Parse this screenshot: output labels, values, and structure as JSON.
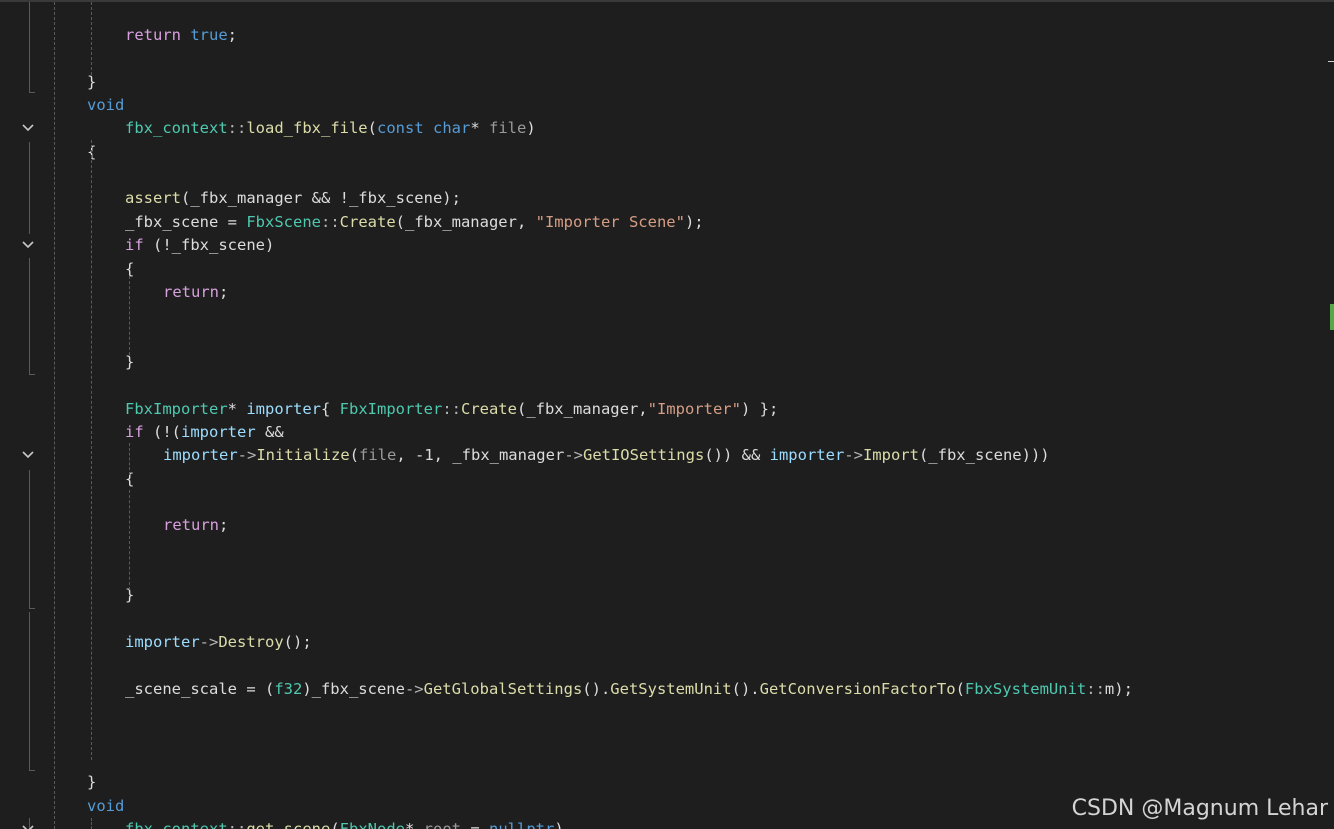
{
  "editor": {
    "lines": [
      {
        "indent": 2,
        "fold": false,
        "tokens": [
          {
            "t": "return",
            "c": "ctl"
          },
          {
            "t": " ",
            "c": "pl"
          },
          {
            "t": "true",
            "c": "kw"
          },
          {
            "t": ";",
            "c": "pl"
          }
        ]
      },
      {
        "indent": 1,
        "fold": false,
        "tokens": []
      },
      {
        "indent": 1,
        "fold": false,
        "tokens": [
          {
            "t": "}",
            "c": "pl"
          }
        ]
      },
      {
        "indent": 1,
        "fold": false,
        "tokens": [
          {
            "t": "void",
            "c": "kw"
          }
        ]
      },
      {
        "indent": 2,
        "fold": true,
        "tokens": [
          {
            "t": "fbx_context",
            "c": "typ"
          },
          {
            "t": "::",
            "c": "op"
          },
          {
            "t": "load_fbx_file",
            "c": "fn"
          },
          {
            "t": "(",
            "c": "pl"
          },
          {
            "t": "const",
            "c": "kw"
          },
          {
            "t": " ",
            "c": "pl"
          },
          {
            "t": "char",
            "c": "kw"
          },
          {
            "t": "* ",
            "c": "pl"
          },
          {
            "t": "file",
            "c": "param"
          },
          {
            "t": ")",
            "c": "pl"
          }
        ]
      },
      {
        "indent": 1,
        "fold": false,
        "tokens": [
          {
            "t": "{",
            "c": "pl"
          }
        ]
      },
      {
        "indent": 2,
        "fold": false,
        "tokens": []
      },
      {
        "indent": 2,
        "fold": false,
        "tokens": [
          {
            "t": "assert",
            "c": "fn"
          },
          {
            "t": "(_fbx_manager && !_fbx_scene);",
            "c": "pl"
          }
        ]
      },
      {
        "indent": 2,
        "fold": false,
        "tokens": [
          {
            "t": "_fbx_scene = ",
            "c": "pl"
          },
          {
            "t": "FbxScene",
            "c": "typ"
          },
          {
            "t": "::",
            "c": "op"
          },
          {
            "t": "Create",
            "c": "fn"
          },
          {
            "t": "(_fbx_manager, ",
            "c": "pl"
          },
          {
            "t": "\"Importer Scene\"",
            "c": "str"
          },
          {
            "t": ");",
            "c": "pl"
          }
        ]
      },
      {
        "indent": 2,
        "fold": true,
        "tokens": [
          {
            "t": "if",
            "c": "ctl"
          },
          {
            "t": " (!_fbx_scene)",
            "c": "pl"
          }
        ]
      },
      {
        "indent": 2,
        "fold": false,
        "tokens": [
          {
            "t": "{",
            "c": "pl"
          }
        ]
      },
      {
        "indent": 3,
        "fold": false,
        "tokens": [
          {
            "t": "return",
            "c": "ctl"
          },
          {
            "t": ";",
            "c": "pl"
          }
        ]
      },
      {
        "indent": 3,
        "fold": false,
        "tokens": []
      },
      {
        "indent": 3,
        "fold": false,
        "tokens": []
      },
      {
        "indent": 2,
        "fold": false,
        "tokens": [
          {
            "t": "}",
            "c": "pl"
          }
        ]
      },
      {
        "indent": 2,
        "fold": false,
        "tokens": []
      },
      {
        "indent": 2,
        "fold": false,
        "tokens": [
          {
            "t": "FbxImporter",
            "c": "typ"
          },
          {
            "t": "* ",
            "c": "pl"
          },
          {
            "t": "importer",
            "c": "var"
          },
          {
            "t": "{ ",
            "c": "pl"
          },
          {
            "t": "FbxImporter",
            "c": "typ"
          },
          {
            "t": "::",
            "c": "op"
          },
          {
            "t": "Create",
            "c": "fn"
          },
          {
            "t": "(_fbx_manager,",
            "c": "pl"
          },
          {
            "t": "\"Importer\"",
            "c": "str"
          },
          {
            "t": ") };",
            "c": "pl"
          }
        ]
      },
      {
        "indent": 2,
        "fold": false,
        "tokens": [
          {
            "t": "if",
            "c": "ctl"
          },
          {
            "t": " (!(",
            "c": "pl"
          },
          {
            "t": "importer",
            "c": "var"
          },
          {
            "t": " &&",
            "c": "pl"
          }
        ]
      },
      {
        "indent": 3,
        "fold": true,
        "tokens": [
          {
            "t": "importer",
            "c": "var"
          },
          {
            "t": "->",
            "c": "op"
          },
          {
            "t": "Initialize",
            "c": "fn"
          },
          {
            "t": "(",
            "c": "pl"
          },
          {
            "t": "file",
            "c": "param"
          },
          {
            "t": ", -1, _fbx_manager",
            "c": "pl"
          },
          {
            "t": "->",
            "c": "op"
          },
          {
            "t": "GetIOSettings",
            "c": "fn"
          },
          {
            "t": "()) && ",
            "c": "pl"
          },
          {
            "t": "importer",
            "c": "var"
          },
          {
            "t": "->",
            "c": "op"
          },
          {
            "t": "Import",
            "c": "fn"
          },
          {
            "t": "(_fbx_scene)))",
            "c": "pl"
          }
        ]
      },
      {
        "indent": 2,
        "fold": false,
        "tokens": [
          {
            "t": "{",
            "c": "pl"
          }
        ]
      },
      {
        "indent": 3,
        "fold": false,
        "tokens": []
      },
      {
        "indent": 3,
        "fold": false,
        "tokens": [
          {
            "t": "return",
            "c": "ctl"
          },
          {
            "t": ";",
            "c": "pl"
          }
        ]
      },
      {
        "indent": 3,
        "fold": false,
        "tokens": []
      },
      {
        "indent": 3,
        "fold": false,
        "tokens": []
      },
      {
        "indent": 2,
        "fold": false,
        "tokens": [
          {
            "t": "}",
            "c": "pl"
          }
        ]
      },
      {
        "indent": 2,
        "fold": false,
        "tokens": []
      },
      {
        "indent": 2,
        "fold": false,
        "tokens": [
          {
            "t": "importer",
            "c": "var"
          },
          {
            "t": "->",
            "c": "op"
          },
          {
            "t": "Destroy",
            "c": "fn"
          },
          {
            "t": "();",
            "c": "pl"
          }
        ]
      },
      {
        "indent": 2,
        "fold": false,
        "tokens": []
      },
      {
        "indent": 2,
        "fold": false,
        "tokens": [
          {
            "t": "_scene_scale = (",
            "c": "pl"
          },
          {
            "t": "f32",
            "c": "typ"
          },
          {
            "t": ")_fbx_scene",
            "c": "pl"
          },
          {
            "t": "->",
            "c": "op"
          },
          {
            "t": "GetGlobalSettings",
            "c": "fn"
          },
          {
            "t": "().",
            "c": "pl"
          },
          {
            "t": "GetSystemUnit",
            "c": "fn"
          },
          {
            "t": "().",
            "c": "pl"
          },
          {
            "t": "GetConversionFactorTo",
            "c": "fn"
          },
          {
            "t": "(",
            "c": "pl"
          },
          {
            "t": "FbxSystemUnit",
            "c": "typ"
          },
          {
            "t": "::",
            "c": "op"
          },
          {
            "t": "m);",
            "c": "pl"
          }
        ]
      },
      {
        "indent": 2,
        "fold": false,
        "tokens": []
      },
      {
        "indent": 2,
        "fold": false,
        "tokens": []
      },
      {
        "indent": 2,
        "fold": false,
        "tokens": []
      },
      {
        "indent": 1,
        "fold": false,
        "tokens": [
          {
            "t": "}",
            "c": "pl"
          }
        ]
      },
      {
        "indent": 1,
        "fold": false,
        "tokens": [
          {
            "t": "void",
            "c": "kw"
          }
        ]
      },
      {
        "indent": 2,
        "fold": true,
        "tokens": [
          {
            "t": "fbx_context",
            "c": "typ"
          },
          {
            "t": "::",
            "c": "op"
          },
          {
            "t": "get_scene",
            "c": "fn"
          },
          {
            "t": "(",
            "c": "pl"
          },
          {
            "t": "FbxNode",
            "c": "typ"
          },
          {
            "t": "* ",
            "c": "pl"
          },
          {
            "t": "root",
            "c": "param"
          },
          {
            "t": " = ",
            "c": "pl"
          },
          {
            "t": "nullptr",
            "c": "kw"
          },
          {
            "t": ")",
            "c": "pl"
          }
        ]
      },
      {
        "indent": 1,
        "fold": false,
        "tokens": [
          {
            "t": "{",
            "c": "pl"
          }
        ]
      }
    ]
  },
  "icons": {
    "fold": "chevron-down-icon"
  },
  "colors": {
    "background": "#1e1e1e",
    "keyword": "#569cd6",
    "control": "#d8a0df",
    "type": "#4ec9b0",
    "function": "#dcdcaa",
    "string": "#d69d85",
    "variable": "#9cdcfe",
    "parameter": "#9a9a9a",
    "change_marker": "#57a64a"
  },
  "watermark": "CSDN @Magnum Lehar"
}
